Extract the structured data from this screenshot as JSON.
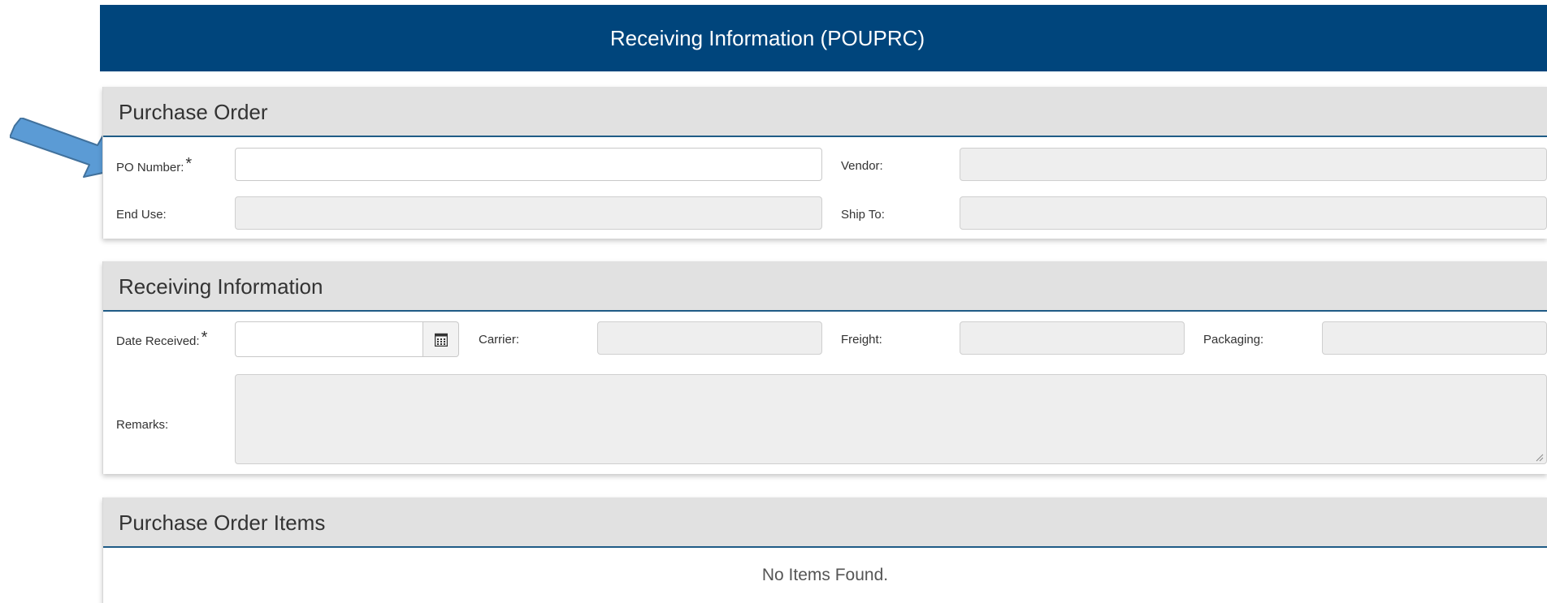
{
  "header": {
    "title": "Receiving Information (POUPRC)"
  },
  "purchase_order": {
    "title": "Purchase Order",
    "po_number": {
      "label": "PO Number:",
      "required": "*",
      "value": ""
    },
    "vendor": {
      "label": "Vendor:",
      "value": ""
    },
    "end_use": {
      "label": "End Use:",
      "value": ""
    },
    "ship_to": {
      "label": "Ship To:",
      "value": ""
    }
  },
  "receiving": {
    "title": "Receiving Information",
    "date_received": {
      "label": "Date Received:",
      "required": "*",
      "value": ""
    },
    "carrier": {
      "label": "Carrier:",
      "value": ""
    },
    "freight": {
      "label": "Freight:",
      "value": ""
    },
    "packaging": {
      "label": "Packaging:",
      "value": ""
    },
    "remarks": {
      "label": "Remarks:",
      "value": ""
    }
  },
  "items": {
    "title": "Purchase Order Items",
    "empty_message": "No Items Found."
  },
  "icons": {
    "calendar": "calendar-icon",
    "pointer": "pointer-arrow-icon"
  },
  "colors": {
    "header_bg": "#00457c",
    "panel_head_bg": "#e1e1e1",
    "panel_rule": "#1f5b86",
    "readonly_field_bg": "#eeeeee",
    "arrow_fill": "#5b9bd5"
  }
}
